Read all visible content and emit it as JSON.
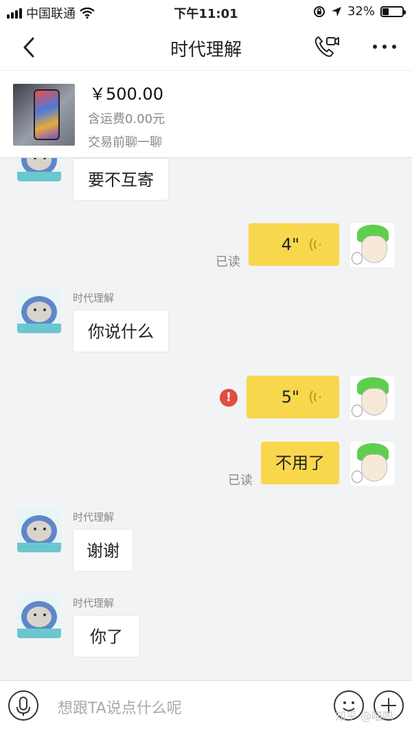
{
  "status_bar": {
    "carrier": "中国联通",
    "time": "下午11:01",
    "battery": "32%",
    "battery_level": 0.32
  },
  "nav": {
    "title": "时代理解"
  },
  "product": {
    "price": "￥500.00",
    "shipping": "含运费0.00元",
    "note": "交易前聊一聊"
  },
  "messages": {
    "m1": {
      "text": "要不互寄"
    },
    "m2": {
      "duration": "4\"",
      "status": "已读"
    },
    "m3": {
      "sender": "时代理解",
      "text": "你说什么"
    },
    "m4": {
      "duration": "5\"",
      "error": "!"
    },
    "m5": {
      "text": "不用了",
      "status": "已读"
    },
    "m6": {
      "sender": "时代理解",
      "text": "谢谢"
    },
    "m7": {
      "sender": "时代理解",
      "text": "你了"
    }
  },
  "input": {
    "placeholder": "想跟TA说点什么呢"
  },
  "watermark": "知乎 @喵鸣"
}
